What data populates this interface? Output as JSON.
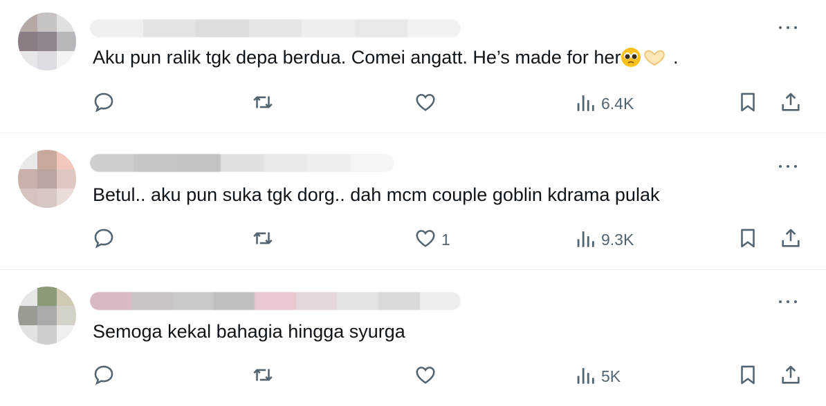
{
  "replies": [
    {
      "text": "Aku pun ralik tgk depa berdua. Comei angatt. He’s made for her",
      "trailing": ".",
      "has_emoji": true,
      "like_count": "",
      "view_count": "6.4K",
      "avatar_colors": [
        "#b5a9a6",
        "#c6c3c2",
        "#e0e0e0",
        "#8b7d85",
        "#8f858e",
        "#b8b8bc",
        "#e8e6ea",
        "#dddce2",
        "#f4f4f6"
      ],
      "name_colors": [
        "#f0f0f0",
        "#e4e4e4",
        "#dddddd",
        "#e6e6e6",
        "#eeeeee",
        "#e8e8e8",
        "#f2f2f2"
      ]
    },
    {
      "text": "Betul.. aku pun suka tgk dorg.. dah mcm couple goblin kdrama pulak",
      "trailing": "",
      "has_emoji": false,
      "like_count": "1",
      "view_count": "9.3K",
      "avatar_colors": [
        "#e8e8e8",
        "#c9a89d",
        "#f3c6bb",
        "#c9b0aa",
        "#b9a49f",
        "#dfc7c2",
        "#d8c4bf",
        "#d6c7c3",
        "#eadcd8"
      ],
      "name_colors": [
        "#cfcfcf",
        "#c6c6c6",
        "#c3c3c3",
        "#e1e1e1",
        "#e8e8e8",
        "#eeeeee",
        "#f5f5f5"
      ]
    },
    {
      "text": "Semoga kekal bahagia hingga syurga",
      "trailing": "",
      "has_emoji": false,
      "like_count": "",
      "view_count": "5K",
      "avatar_colors": [
        "#e6e6e6",
        "#8a9b7a",
        "#cfcab4",
        "#9a9c94",
        "#a9aba8",
        "#d4d2c8",
        "#e2e2e2",
        "#cfcfcf",
        "#efefef"
      ],
      "name_colors": [
        "#d9b9c2",
        "#c9c3c6",
        "#c9c9c9",
        "#bfbfbf",
        "#e9c9cf",
        "#e3d7dc",
        "#e3e3e3",
        "#d9d9d9",
        "#eeeeee"
      ]
    }
  ],
  "colors": {
    "icon": "#536471",
    "text": "#0f1419",
    "divider": "#eff3f4"
  },
  "icons": [
    "reply-icon",
    "retweet-icon",
    "like-icon",
    "views-icon",
    "bookmark-icon",
    "share-icon",
    "more-icon"
  ]
}
